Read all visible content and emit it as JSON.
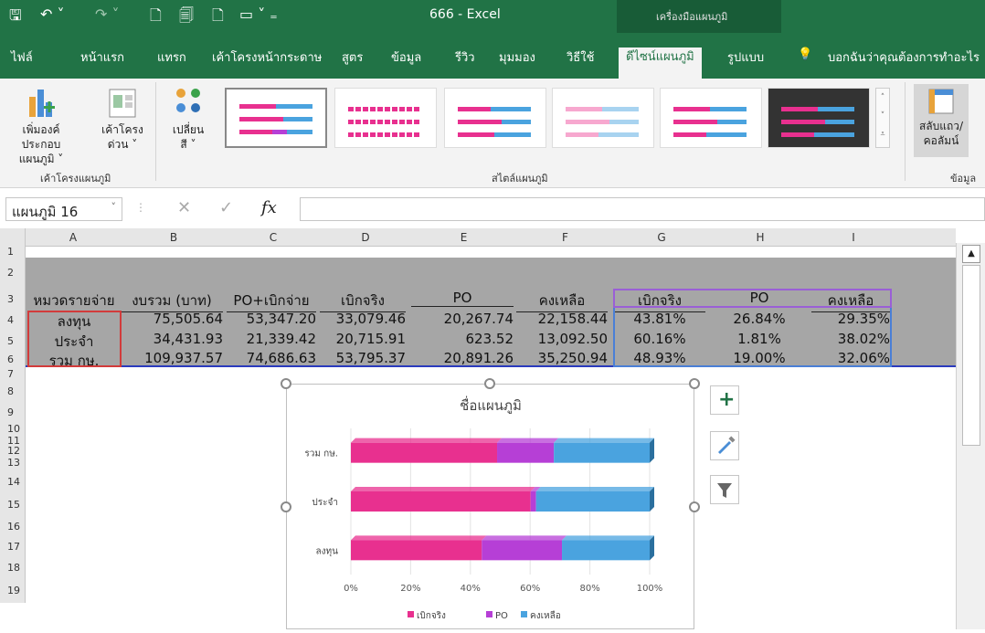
{
  "app": {
    "doc_title": "666  -  Excel",
    "context_title": "เครื่องมือแผนภูมิ"
  },
  "tabs": [
    {
      "label": "ไฟล์"
    },
    {
      "label": "หน้าแรก"
    },
    {
      "label": "แทรก"
    },
    {
      "label": "เค้าโครงหน้ากระดาษ"
    },
    {
      "label": "สูตร"
    },
    {
      "label": "ข้อมูล"
    },
    {
      "label": "รีวิว"
    },
    {
      "label": "มุมมอง"
    },
    {
      "label": "วิธีใช้"
    },
    {
      "label": "ดีไซน์แผนภูมิ"
    },
    {
      "label": "รูปแบบ"
    }
  ],
  "tell_me": "บอกฉันว่าคุณต้องการทำอะไร",
  "ribbon": {
    "add_element": "เพิ่มองค์ประกอบ\nแผนภูมิ ˅",
    "quick_layout": "เค้าโครง\nด่วน ˅",
    "change_color": "เปลี่ยน\nสี ˅",
    "group_layout": "เค้าโครงแผนภูมิ",
    "group_styles": "สไตล์แผนภูมิ",
    "switch_row_col": "สลับแถว/\nคอลัมน์",
    "group_data": "ข้อมูล"
  },
  "namebox": "แผนภูมิ 16",
  "fx": "fx",
  "columns": [
    "A",
    "B",
    "C",
    "D",
    "E",
    "F",
    "G",
    "H",
    "I"
  ],
  "rows": [
    "1",
    "2",
    "3",
    "4",
    "5",
    "6",
    "7",
    "8",
    "9",
    "10",
    "11",
    "12",
    "13",
    "14",
    "15",
    "16",
    "17",
    "18",
    "19"
  ],
  "table": {
    "headers": [
      "หมวดรายจ่าย",
      "งบรวม (บาท)",
      "PO+เบิกจ่าย",
      "เบิกจริง",
      "PO",
      "คงเหลือ",
      "เบิกจริง",
      "PO",
      "คงเหลือ"
    ],
    "rows": [
      [
        "ลงทุน",
        "75,505.64",
        "53,347.20",
        "33,079.46",
        "20,267.74",
        "22,158.44",
        "43.81%",
        "26.84%",
        "29.35%"
      ],
      [
        "ประจำ",
        "34,431.93",
        "21,339.42",
        "20,715.91",
        "623.52",
        "13,092.50",
        "60.16%",
        "1.81%",
        "38.02%"
      ],
      [
        "รวม กษ.",
        "109,937.57",
        "74,686.63",
        "53,795.37",
        "20,891.26",
        "35,250.94",
        "48.93%",
        "19.00%",
        "32.06%"
      ]
    ]
  },
  "chart_data": {
    "type": "bar",
    "title": "ชื่อแผนภูมิ",
    "orientation": "horizontal",
    "stacked": "100%",
    "categories": [
      "ลงทุน",
      "ประจำ",
      "รวม กษ."
    ],
    "series": [
      {
        "name": "เบิกจริง",
        "values": [
          43.81,
          60.16,
          48.93
        ],
        "color": "#e8308f"
      },
      {
        "name": "PO",
        "values": [
          26.84,
          1.81,
          19.0
        ],
        "color": "#b63fd6"
      },
      {
        "name": "คงเหลือ",
        "values": [
          29.35,
          38.02,
          32.06
        ],
        "color": "#4aa3df"
      }
    ],
    "xlim": [
      0,
      100
    ],
    "xticks": [
      "0%",
      "20%",
      "40%",
      "60%",
      "80%",
      "100%"
    ],
    "legend": "bottom",
    "grid": true
  }
}
